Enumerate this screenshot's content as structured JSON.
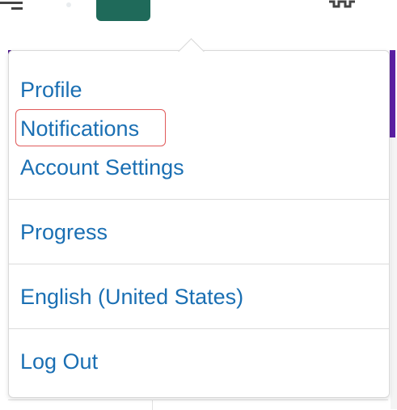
{
  "menu": {
    "items": [
      {
        "label": "Profile"
      },
      {
        "label": "Notifications"
      },
      {
        "label": "Account Settings"
      },
      {
        "label": "Progress"
      },
      {
        "label": "English (United States)"
      },
      {
        "label": "Log Out"
      }
    ],
    "highlighted_item": "Notifications"
  },
  "colors": {
    "link": "#1a6fb3",
    "highlight_border": "#e05a5a",
    "accent_purple": "#5b1fa3",
    "avatar_tile": "#1f6a5a"
  },
  "icons": {
    "top_left": "hamburger-icon",
    "top_right": "gear-icon"
  }
}
